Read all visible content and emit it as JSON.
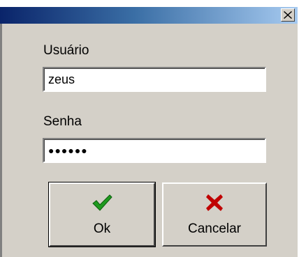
{
  "window": {
    "close_glyph": "✕",
    "colors": {
      "face": "#d4d0c8",
      "title_start": "#0a246a",
      "title_end": "#a6caf0",
      "ok_check": "#1f9a1f",
      "cancel_x": "#c00000"
    }
  },
  "form": {
    "username_label": "Usuário",
    "username_value": "zeus",
    "password_label": "Senha",
    "password_mask": "●●●●●●"
  },
  "buttons": {
    "ok_label": "Ok",
    "ok_icon": "check-icon",
    "cancel_label": "Cancelar",
    "cancel_icon": "x-icon"
  }
}
